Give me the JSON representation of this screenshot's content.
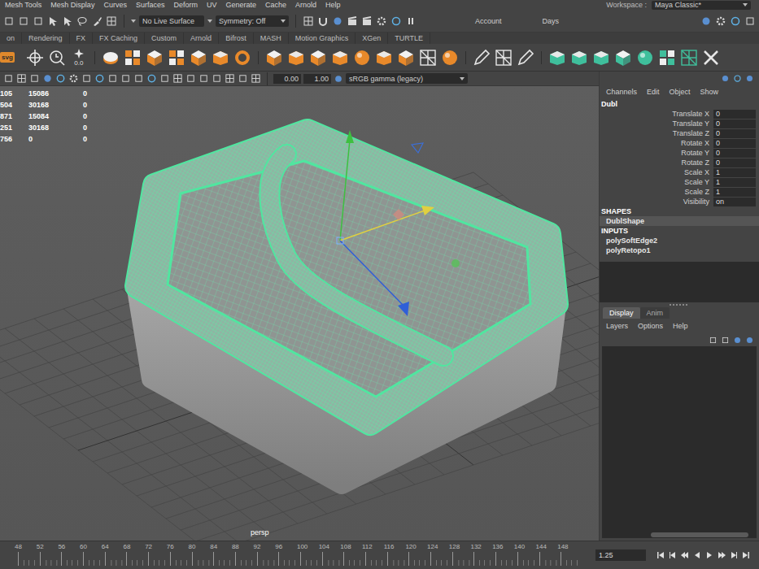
{
  "menu_bar": {
    "items": [
      "Mesh Tools",
      "Mesh Display",
      "Curves",
      "Surfaces",
      "Deform",
      "UV",
      "Generate",
      "Cache",
      "Arnold",
      "Help"
    ],
    "workspace_label": "Workspace :",
    "workspace": "Maya Classic*"
  },
  "status_line": {
    "live_surface": "No Live Surface",
    "symmetry": "Symmetry: Off",
    "account": "Account",
    "days": "Days"
  },
  "shelf": {
    "tabs": [
      {
        "label": "on",
        "selected": false
      },
      {
        "label": "Rendering",
        "selected": false
      },
      {
        "label": "FX",
        "selected": false
      },
      {
        "label": "FX Caching",
        "selected": false
      },
      {
        "label": "Custom",
        "selected": false
      },
      {
        "label": "Arnold",
        "selected": false
      },
      {
        "label": "Bifrost",
        "selected": false
      },
      {
        "label": "MASH",
        "selected": false
      },
      {
        "label": "Motion Graphics",
        "selected": false
      },
      {
        "label": "XGen",
        "selected": false
      },
      {
        "label": "TURTLE",
        "selected": false
      }
    ],
    "badge": "svg",
    "readout": "0.0"
  },
  "viewport": {
    "toolbar": {
      "exposure": "0.00",
      "gamma": "1.00",
      "color_space": "sRGB gamma (legacy)"
    },
    "hud": [
      {
        "cells": [
          "105",
          "15086",
          "0"
        ]
      },
      {
        "cells": [
          "504",
          "30168",
          "0"
        ]
      },
      {
        "cells": [
          "871",
          "15084",
          "0"
        ]
      },
      {
        "cells": [
          "251",
          "30168",
          "0"
        ]
      },
      {
        "cells": [
          "756",
          "0",
          "0"
        ]
      }
    ],
    "camera": "persp"
  },
  "channel_box": {
    "menus": [
      "Channels",
      "Edit",
      "Object",
      "Show"
    ],
    "object": "Dubl",
    "attributes": [
      {
        "name": "Translate X",
        "value": "0"
      },
      {
        "name": "Translate Y",
        "value": "0"
      },
      {
        "name": "Translate Z",
        "value": "0"
      },
      {
        "name": "Rotate X",
        "value": "0"
      },
      {
        "name": "Rotate Y",
        "value": "0"
      },
      {
        "name": "Rotate Z",
        "value": "0"
      },
      {
        "name": "Scale X",
        "value": "1"
      },
      {
        "name": "Scale Y",
        "value": "1"
      },
      {
        "name": "Scale Z",
        "value": "1"
      },
      {
        "name": "Visibility",
        "value": "on"
      }
    ],
    "shapes_heading": "SHAPES",
    "shapes": [
      {
        "label": "DublShape",
        "selected": true
      }
    ],
    "inputs_heading": "INPUTS",
    "inputs": [
      "polySoftEdge2",
      "polyRetopo1"
    ]
  },
  "layer_editor": {
    "tabs": [
      {
        "label": "Display",
        "selected": true
      },
      {
        "label": "Anim",
        "selected": false
      }
    ],
    "menus": [
      "Layers",
      "Options",
      "Help"
    ]
  },
  "timeline": {
    "ticks": [
      "48",
      "52",
      "56",
      "60",
      "64",
      "68",
      "72",
      "76",
      "80",
      "84",
      "88",
      "92",
      "96",
      "100",
      "104",
      "108",
      "112",
      "116",
      "120",
      "124",
      "128",
      "132",
      "136",
      "140",
      "144",
      "148"
    ],
    "current": "1.25"
  }
}
